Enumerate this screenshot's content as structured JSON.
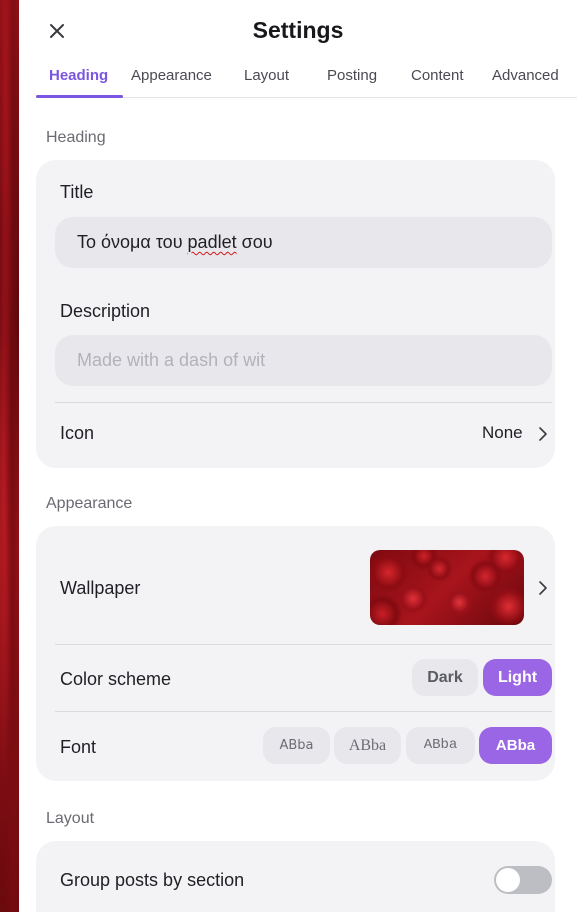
{
  "header": {
    "title": "Settings"
  },
  "tabs": [
    {
      "label": "Heading",
      "active": true
    },
    {
      "label": "Appearance",
      "active": false
    },
    {
      "label": "Layout",
      "active": false
    },
    {
      "label": "Posting",
      "active": false
    },
    {
      "label": "Content",
      "active": false
    },
    {
      "label": "Advanced",
      "active": false
    }
  ],
  "heading_section": {
    "label": "Heading",
    "title_label": "Title",
    "title_value_prefix": "Το όνομα του ",
    "title_value_misspelled": "padlet",
    "title_value_suffix": " σου",
    "description_label": "Description",
    "description_placeholder": "Made with a dash of wit",
    "icon_label": "Icon",
    "icon_value": "None"
  },
  "appearance_section": {
    "label": "Appearance",
    "wallpaper_label": "Wallpaper",
    "color_scheme_label": "Color scheme",
    "color_scheme_options": [
      "Dark",
      "Light"
    ],
    "color_scheme_selected": "Light",
    "font_label": "Font",
    "font_options": [
      "ABba",
      "ABba",
      "ABba",
      "ABba"
    ],
    "font_selected_index": 3
  },
  "layout_section": {
    "label": "Layout",
    "group_posts_label": "Group posts by section",
    "group_posts_enabled": false
  },
  "colors": {
    "accent": "#7b56e0",
    "selected_button": "#9a66e6",
    "card_bg": "#f3f3f6",
    "input_bg": "#e7e7ec"
  },
  "icons": {
    "close": "close-icon",
    "chevron": "chevron-right-icon"
  }
}
